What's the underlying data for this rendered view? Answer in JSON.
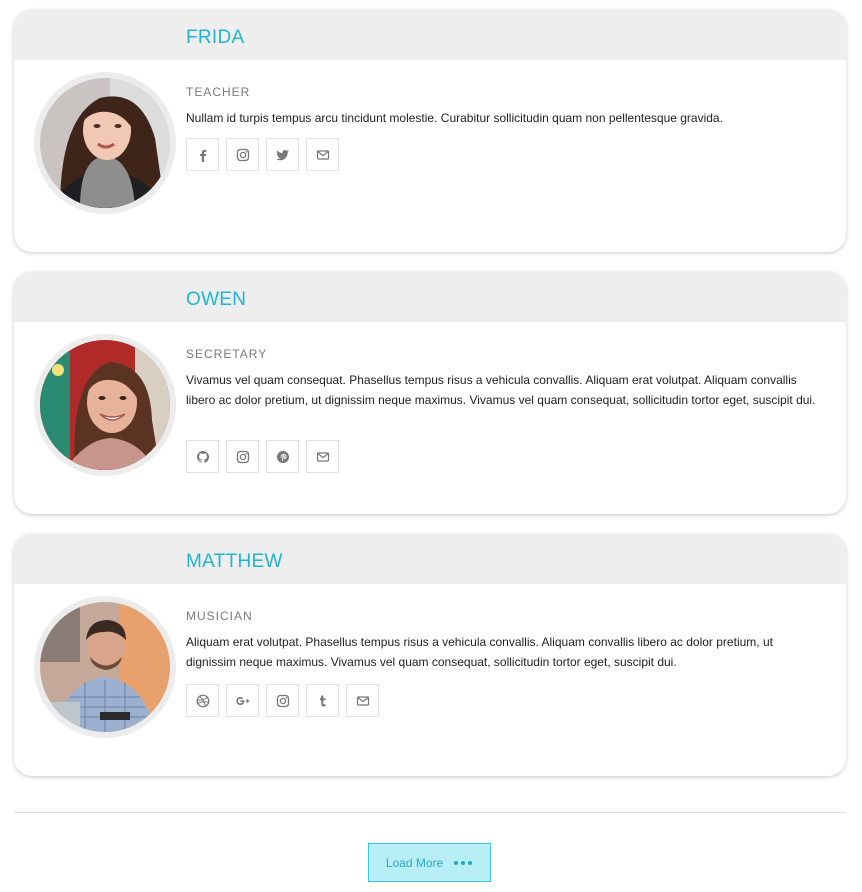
{
  "colors": {
    "accent": "#1fb5d1",
    "card_header_bg": "#eeeeee",
    "icon_color": "#777777",
    "button_bg": "#b8eef6",
    "button_border": "#3ec8df"
  },
  "profiles": [
    {
      "name": "FRIDA",
      "role": "TEACHER",
      "description": "Nullam id turpis tempus arcu tincidunt molestie. Curabitur sollicitudin quam non pellentesque gravida.",
      "avatar": "woman-portrait-photo",
      "socials": [
        "facebook-icon",
        "instagram-icon",
        "twitter-icon",
        "email-icon"
      ]
    },
    {
      "name": "OWEN",
      "role": "SECRETARY",
      "description": "Vivamus vel quam consequat. Phasellus tempus risus a vehicula convallis. Aliquam erat volutpat. Aliquam convallis libero ac dolor pretium, ut dignissim neque maximus. Vivamus vel quam consequat, sollicitudin tortor eget, suscipit dui.",
      "avatar": "smiling-woman-portrait-photo",
      "socials": [
        "github-icon",
        "instagram-icon",
        "pinterest-icon",
        "email-icon"
      ]
    },
    {
      "name": "MATTHEW",
      "role": "MUSICIAN",
      "description": "Aliquam erat volutpat. Phasellus tempus risus a vehicula convallis. Aliquam convallis libero ac dolor pretium, ut dignissim neque maximus. Vivamus vel quam consequat, sollicitudin tortor eget, suscipit dui.",
      "avatar": "man-with-laptop-portrait-photo",
      "socials": [
        "dribbble-icon",
        "google-plus-icon",
        "instagram-icon",
        "tumblr-icon",
        "email-icon"
      ]
    }
  ],
  "load_more": {
    "label": "Load More",
    "icon": "ellipsis-icon"
  }
}
